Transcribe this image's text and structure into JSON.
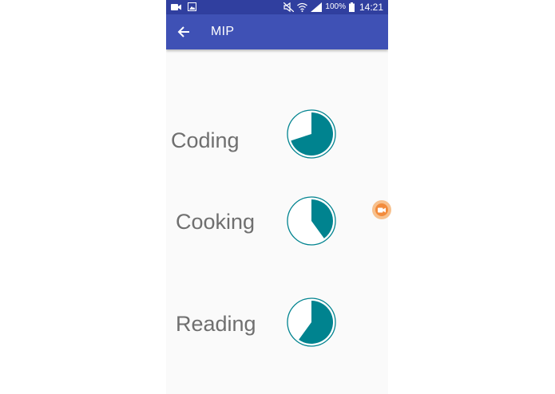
{
  "status_bar": {
    "battery_percent": "100%",
    "time": "14:21",
    "left_icons": [
      "video-camera-icon",
      "image-icon"
    ],
    "right_icons": [
      "mute-icon",
      "wifi-icon",
      "signal-icon",
      "battery-icon"
    ]
  },
  "app_bar": {
    "title": "MIP",
    "back_icon": "arrow-left-icon"
  },
  "colors": {
    "status_bar": "#303f9f",
    "app_bar": "#3f51b5",
    "pie_fill": "#00838f",
    "pie_ring": "#00838f",
    "background": "#fafafa",
    "label_text": "#6f6f6f"
  },
  "items": [
    {
      "label": "Coding",
      "progress_fraction": 0.7
    },
    {
      "label": "Cooking",
      "progress_fraction": 0.4
    },
    {
      "label": "Reading",
      "progress_fraction": 0.6
    }
  ]
}
